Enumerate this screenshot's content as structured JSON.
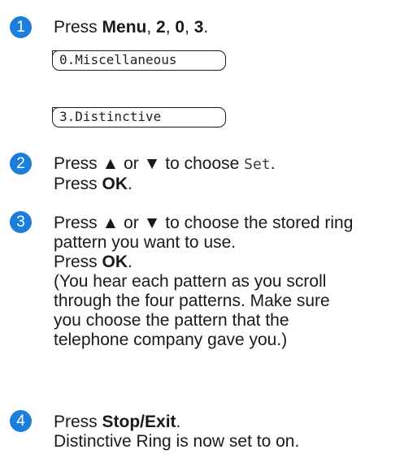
{
  "steps": [
    {
      "number": "1",
      "press": "Press ",
      "key1": "Menu",
      "sep1": ", ",
      "key2": "2",
      "sep2": ", ",
      "key3": "0",
      "sep3": ", ",
      "key4": "3",
      "end": ".",
      "lcd": [
        "0.Miscellaneous",
        "3.Distinctive"
      ]
    },
    {
      "number": "2",
      "line1_pre": "Press ▲ or ▼ to choose ",
      "line1_mono": "Set",
      "line1_post": ".",
      "line2_pre": "Press ",
      "line2_key": "OK",
      "line2_post": "."
    },
    {
      "number": "3",
      "line1": "Press ▲ or ▼ to choose the stored ring",
      "line2": "pattern you want to use.",
      "line3_pre": "Press ",
      "line3_key": "OK",
      "line3_post": ".",
      "line4": "(You hear each pattern as you scroll",
      "line5": "through the four patterns. Make sure",
      "line6": "you choose the pattern that the",
      "line7": "telephone company gave you.)"
    },
    {
      "number": "4",
      "line1_pre": "Press ",
      "line1_key": "Stop/Exit",
      "line1_post": ".",
      "line2": "Distinctive Ring is now set to on."
    }
  ],
  "colors": {
    "badge": "#1a7fdc"
  }
}
